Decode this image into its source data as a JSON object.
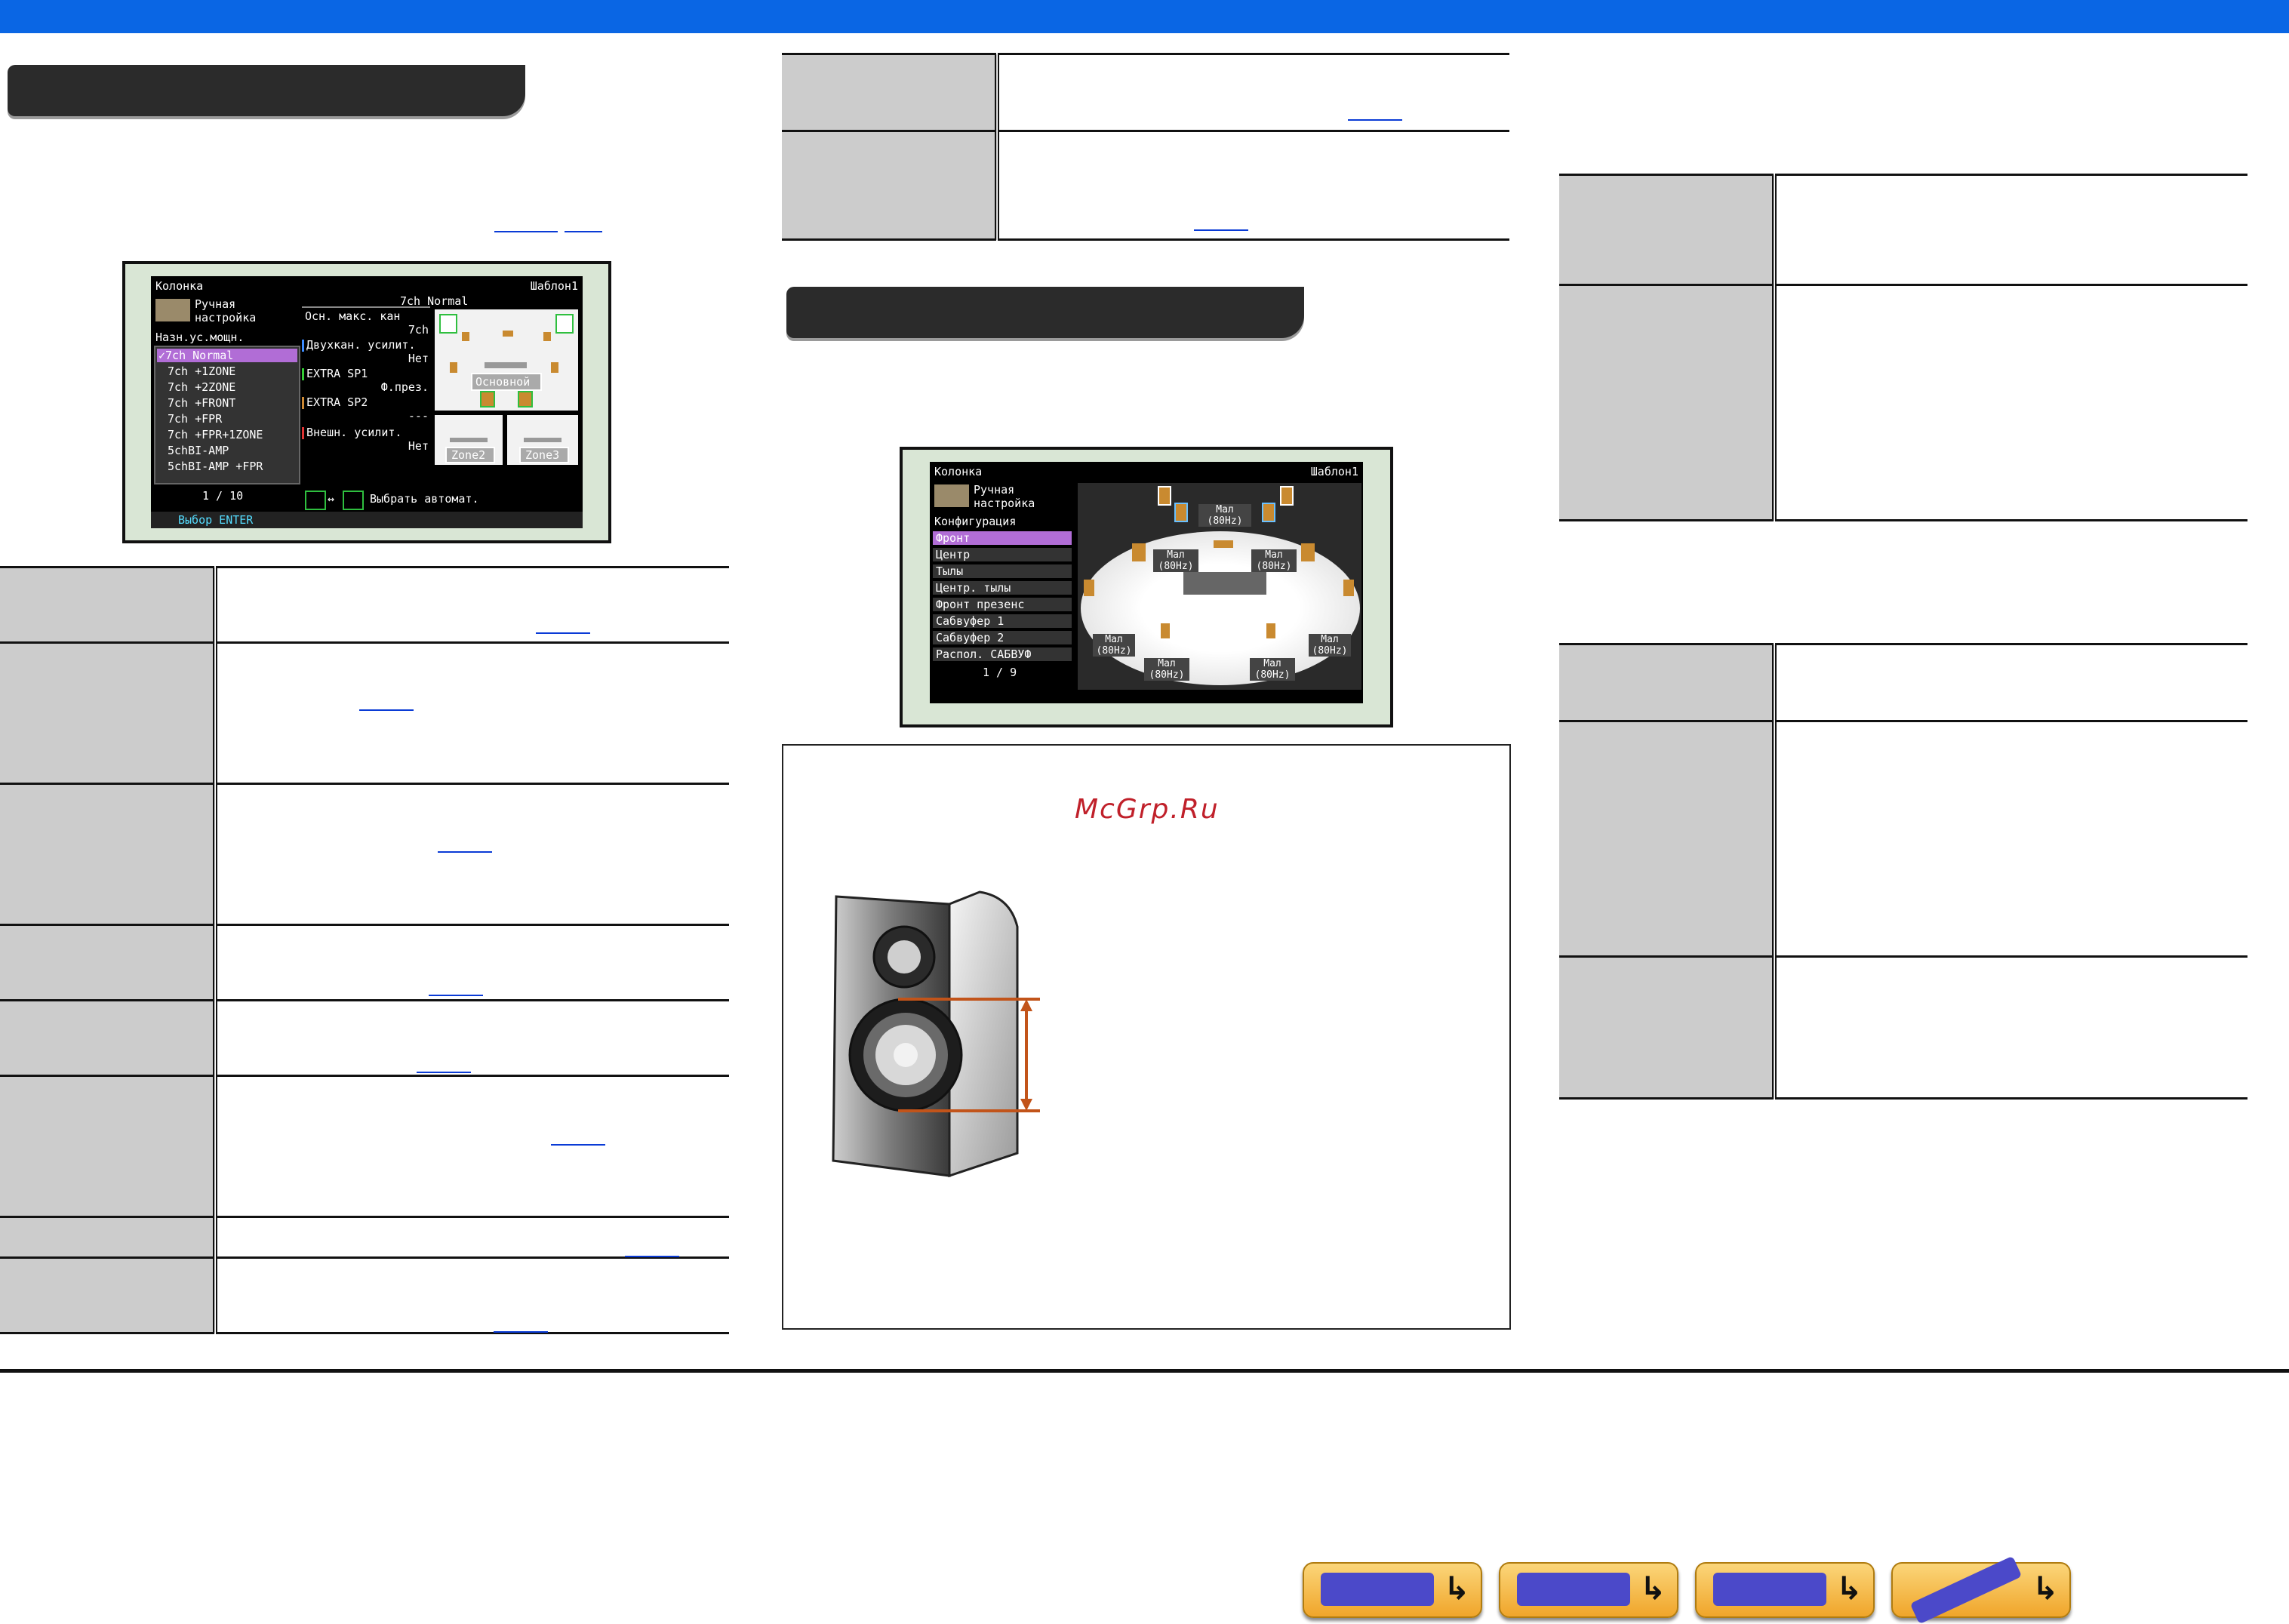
{
  "screen1": {
    "title": "Колонка",
    "template": "Шаблон1",
    "mode_line1": "Ручная",
    "mode_line2": "настройка",
    "assign_label": "Назн.ус.мощн.",
    "options": [
      "✓7ch Normal",
      "7ch +1ZONE",
      "7ch +2ZONE",
      "7ch +FRONT",
      "7ch +FPR",
      "7ch +FPR+1ZONE",
      "5chBI-AMP",
      "5chBI-AMP +FPR"
    ],
    "page": "1 / 10",
    "preset_name": "7ch Normal",
    "params": [
      {
        "label": "Осн. макс. кан",
        "value": "7ch"
      },
      {
        "label": "Двухкан. усилит.",
        "value": "Нет"
      },
      {
        "label": "EXTRA SP1",
        "value": "Ф.през."
      },
      {
        "label": "EXTRA SP2",
        "value": "---"
      },
      {
        "label": "Внешн. усилит.",
        "value": "Нет"
      }
    ],
    "zone_main": "Основной",
    "zone2": "Zone2",
    "zone3": "Zone3",
    "auto_label": "Выбрать автомат.",
    "swap_symbol": "↔",
    "enter_label": "Выбор ENTER"
  },
  "screen2": {
    "title": "Колонка",
    "template": "Шаблон1",
    "mode_line1": "Ручная",
    "mode_line2": "настройка",
    "config_label": "Конфигурация",
    "items": [
      "Фронт",
      "Центр",
      "Тылы",
      "Центр. тылы",
      "Фронт презенс",
      "Сабвуфер 1",
      "Сабвуфер 2",
      "Распол. САБВУФ"
    ],
    "page": "1 / 9",
    "speaker_labels": [
      "Мал (80Hz)",
      "Мал (80Hz)",
      "Мал (80Hz)",
      "Мал (80Hz)",
      "Мал (80Hz)",
      "Мал (80Hz)",
      "Мал (80Hz)"
    ]
  },
  "watermark": "McGrp.Ru"
}
